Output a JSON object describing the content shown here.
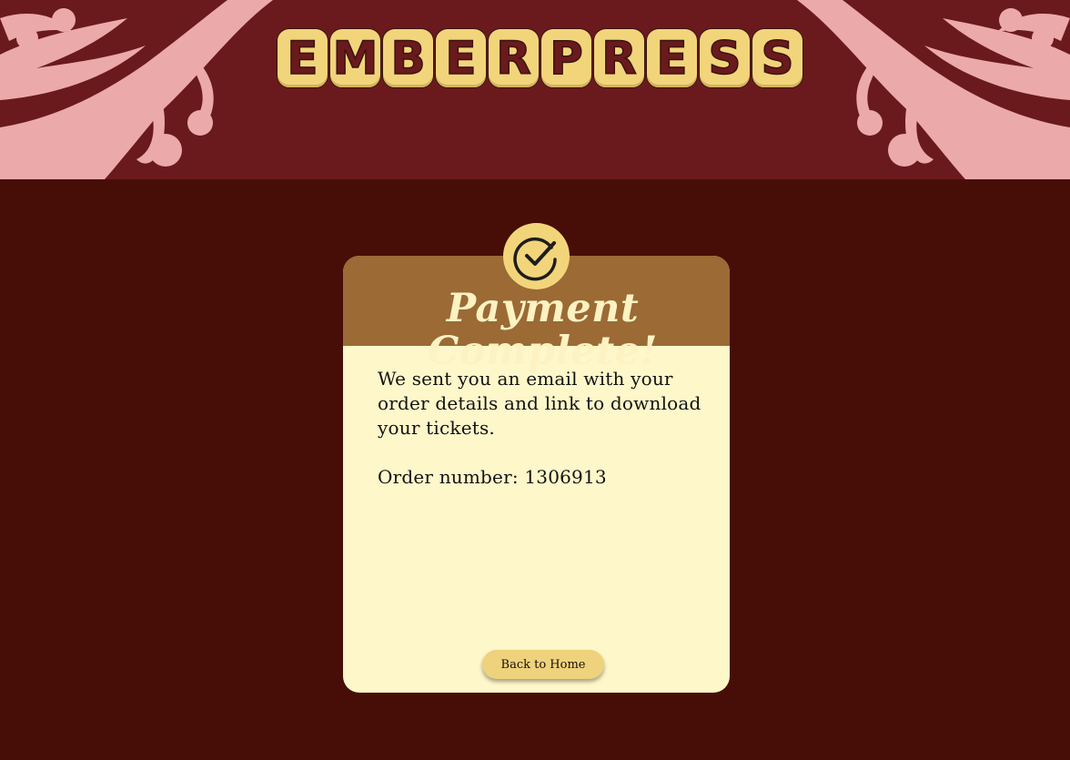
{
  "header": {
    "logo_letters": [
      "E",
      "M",
      "B",
      "E",
      "R",
      "P",
      "R",
      "E",
      "S",
      "S"
    ],
    "colors": {
      "background": "#6a1a1c",
      "ornament": "#ebaaa9",
      "logo_tile": "#f2d57a"
    }
  },
  "card": {
    "badge_icon": "check-circle-icon",
    "title": "Payment Complete!",
    "message": "We sent you an email with your order details and link to download your tickets.",
    "order_label": "Order number:",
    "order_number": "1306913",
    "back_button_label": "Back to Home",
    "colors": {
      "header": "#9b6a35",
      "body": "#fef7ca",
      "button": "#efd27c"
    }
  },
  "page": {
    "background": "#470e08"
  }
}
